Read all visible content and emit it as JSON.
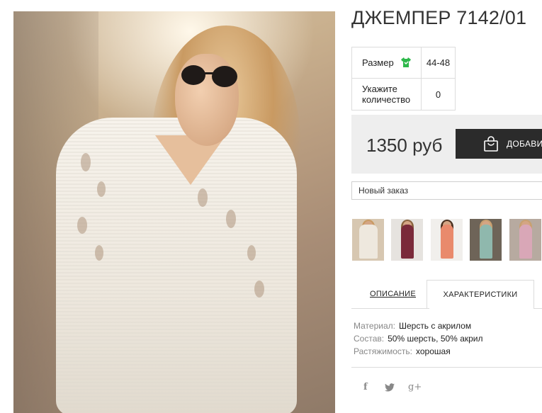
{
  "product": {
    "title": "ДЖЕМПЕР 7142/01"
  },
  "params": {
    "size_label": "Размер",
    "size_value": "44-48",
    "qty_label": "Укажите количество",
    "qty_value": "0"
  },
  "purchase": {
    "price": "1350 руб",
    "add_button": "ДОБАВИТЬ"
  },
  "order": {
    "selected": "Новый заказ"
  },
  "thumbnails": [
    {
      "color": "#e9e4dc",
      "bg": "#d7c7b1"
    },
    {
      "color": "#7a2a3a",
      "bg": "#e6e3df"
    },
    {
      "color": "#e98a6c",
      "bg": "#f1efec"
    },
    {
      "color": "#8fb8ad",
      "bg": "#6e6458"
    },
    {
      "color": "#d9a7b7",
      "bg": "#b7aaa0"
    }
  ],
  "tabs": {
    "description": "ОПИСАНИЕ",
    "characteristics": "ХАРАКТЕРИСТИКИ"
  },
  "specs": [
    {
      "key": "Материал:",
      "value": "Шерсть с акрилом"
    },
    {
      "key": "Состав:",
      "value": "50% шерсть, 50% акрил"
    },
    {
      "key": "Растяжимость:",
      "value": "хорошая"
    }
  ],
  "social": {
    "facebook": "f",
    "twitter": "t",
    "googleplus": "g+"
  },
  "colors": {
    "button_bg": "#2b2b2b",
    "price_bg": "#eeeeee",
    "size_icon": "#2eb84b"
  }
}
